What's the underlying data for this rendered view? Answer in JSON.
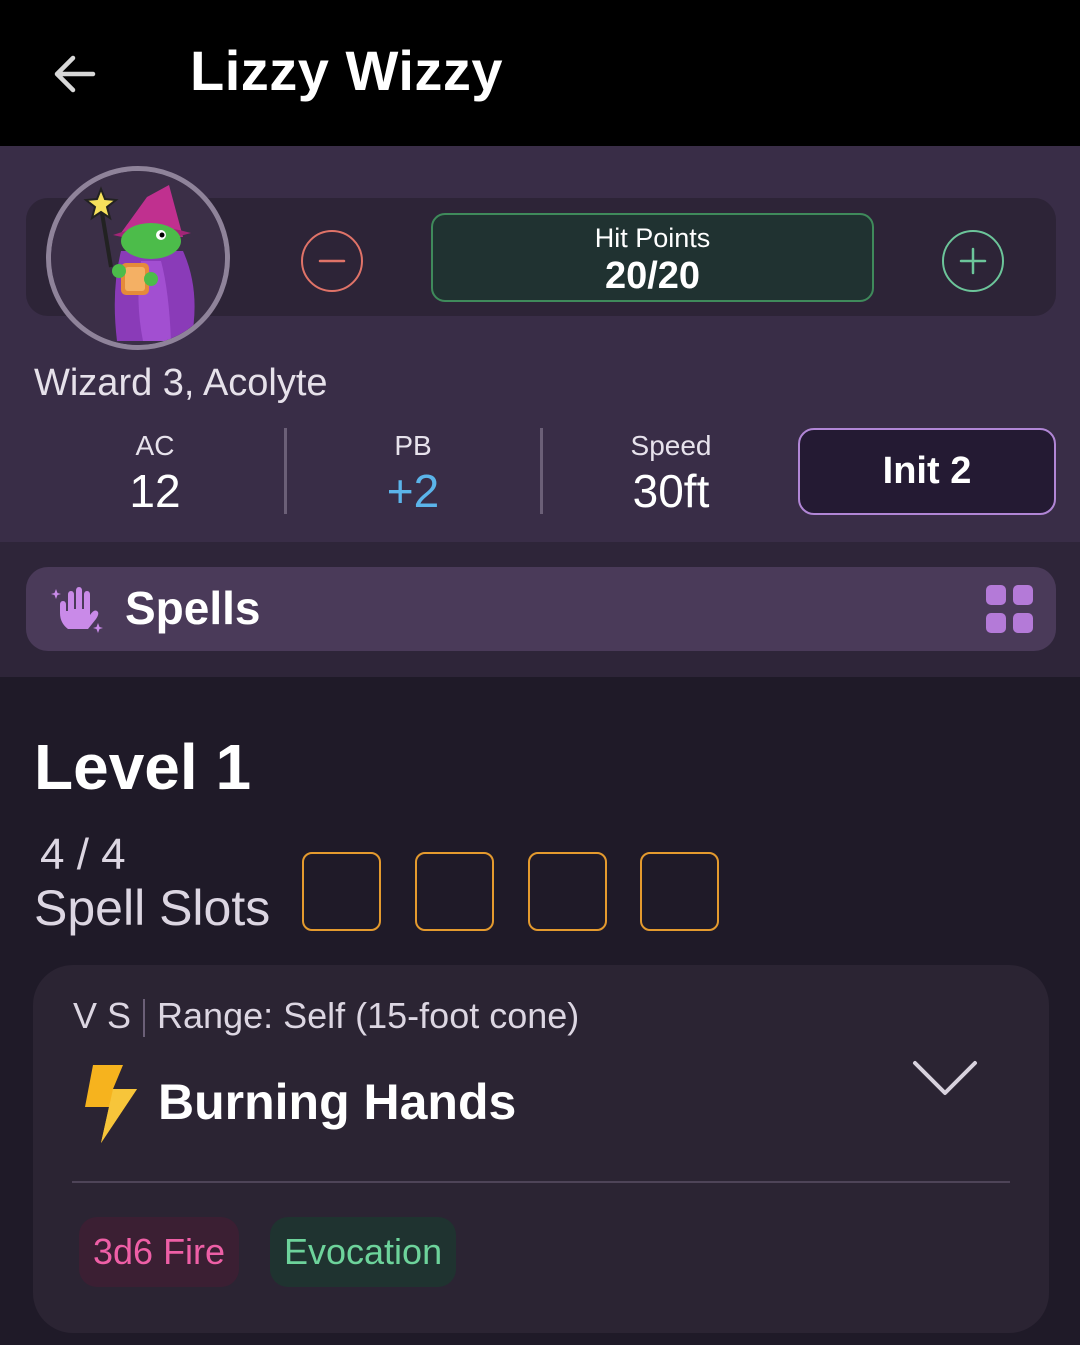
{
  "appbar": {
    "title": "Lizzy Wizzy",
    "back_icon": "arrow-left-icon"
  },
  "character": {
    "avatar_icon": "wizard-lizard-avatar",
    "class_line": "Wizard 3, Acolyte"
  },
  "hit_points": {
    "label": "Hit Points",
    "value": "20/20",
    "minus_icon": "minus-circle-icon",
    "plus_icon": "plus-circle-icon"
  },
  "stats": [
    {
      "label": "AC",
      "value": "12"
    },
    {
      "label": "PB",
      "value": "+2"
    },
    {
      "label": "Speed",
      "value": "30ft"
    }
  ],
  "initiative": {
    "label": "Init 2"
  },
  "section": {
    "title": "Spells",
    "icon": "magic-hand-icon",
    "view_icon": "grid-view-icon"
  },
  "level": {
    "title": "Level 1",
    "slot_count": "4 / 4",
    "slot_label": "Spell Slots",
    "slots": [
      false,
      false,
      false,
      false
    ]
  },
  "spell": {
    "components": "V S",
    "range": "Range: Self (15-foot cone)",
    "name": "Burning Hands",
    "icon": "lightning-bolt-icon",
    "expand_icon": "chevron-down-icon",
    "tags": {
      "damage": "3d6 Fire",
      "school": "Evocation"
    }
  },
  "colors": {
    "appbar_bg": "#000000",
    "header_bg": "#392d47",
    "accent_purple": "#b186d6",
    "hp_green": "#3f8a5b",
    "minus_red": "#e07368",
    "slot_orange": "#e49a2e",
    "pb_blue": "#5bb4ea",
    "damage_pink": "#ee5fa6",
    "school_green": "#6dd39b"
  }
}
